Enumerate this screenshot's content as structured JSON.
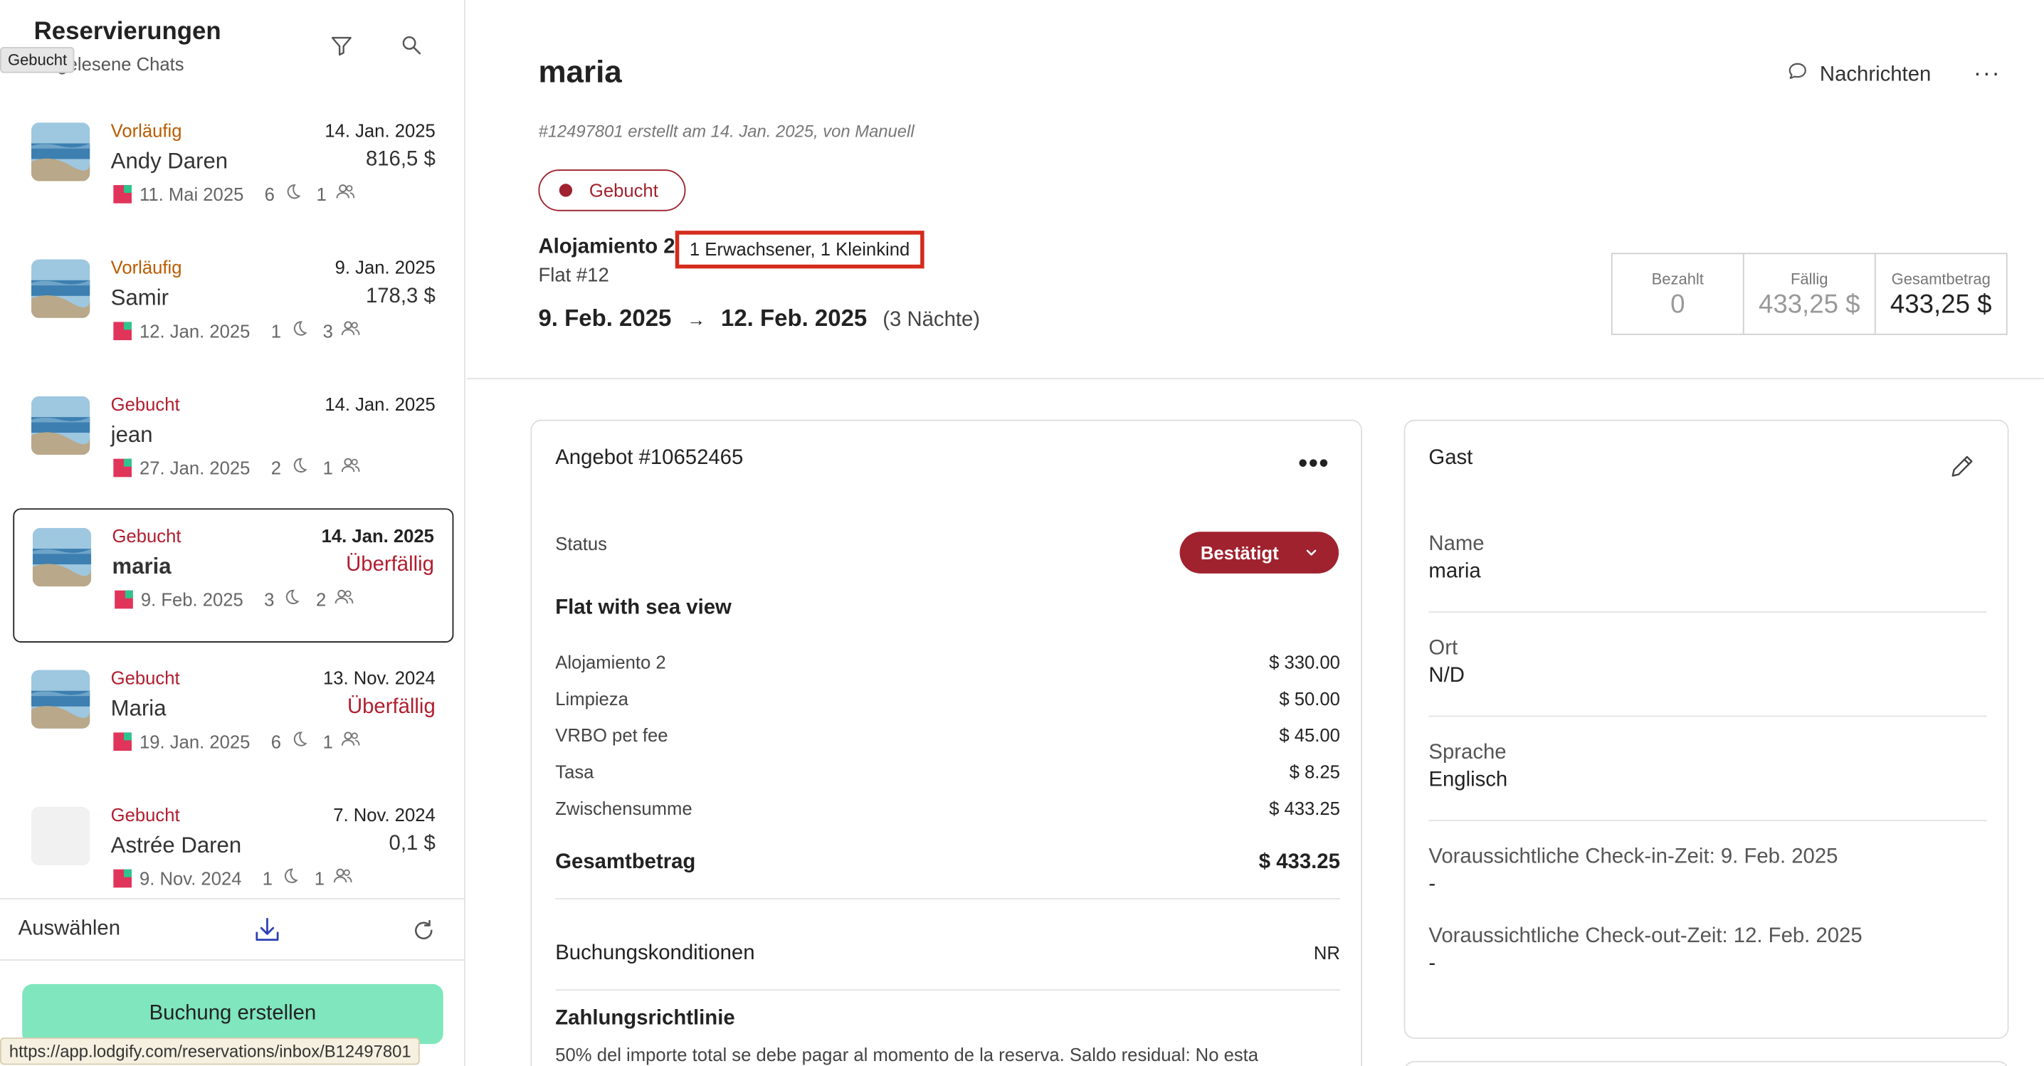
{
  "sidebar": {
    "title": "Reservierungen",
    "subtitle": "Ungelesene Chats",
    "tooltip": "Gebucht",
    "filter_icon": "filter-icon",
    "search_icon": "search-icon",
    "reservations": [
      {
        "status": "Vorläufig",
        "status_color": "#b85c00",
        "date": "14. Jan. 2025",
        "name": "Andy Daren",
        "amount": "816,5 $",
        "amount_color": "#333333",
        "checkin": "11. Mai 2025",
        "nights": "6",
        "guests": "1",
        "active": false,
        "thumb": true
      },
      {
        "status": "Vorläufig",
        "status_color": "#b85c00",
        "date": "9. Jan. 2025",
        "name": "Samir",
        "amount": "178,3 $",
        "amount_color": "#333333",
        "checkin": "12. Jan. 2025",
        "nights": "1",
        "guests": "3",
        "active": false,
        "thumb": true
      },
      {
        "status": "Gebucht",
        "status_color": "#b01e2f",
        "date": "14. Jan. 2025",
        "name": "jean",
        "amount": "",
        "amount_color": "#333333",
        "checkin": "27. Jan. 2025",
        "nights": "2",
        "guests": "1",
        "active": false,
        "thumb": true
      },
      {
        "status": "Gebucht",
        "status_color": "#b01e2f",
        "date": "14. Jan. 2025",
        "name": "maria",
        "amount": "Überfällig",
        "amount_color": "#b01e2f",
        "checkin": "9. Feb. 2025",
        "nights": "3",
        "guests": "2",
        "active": true,
        "thumb": true
      },
      {
        "status": "Gebucht",
        "status_color": "#b01e2f",
        "date": "13. Nov. 2024",
        "name": "Maria",
        "amount": "Überfällig",
        "amount_color": "#b01e2f",
        "checkin": "19. Jan. 2025",
        "nights": "6",
        "guests": "1",
        "active": false,
        "thumb": true
      },
      {
        "status": "Gebucht",
        "status_color": "#b01e2f",
        "date": "7. Nov. 2024",
        "name": "Astrée Daren",
        "amount": "0,1 $",
        "amount_color": "#333333",
        "checkin": "9. Nov. 2024",
        "nights": "1",
        "guests": "1",
        "active": false,
        "thumb": false
      }
    ],
    "select_label": "Auswählen",
    "download_icon": "download-icon",
    "refresh_icon": "refresh-icon",
    "create_button": "Buchung erstellen"
  },
  "statusbar": {
    "url": "https://app.lodgify.com/reservations/inbox/B12497801"
  },
  "header": {
    "guest_name": "maria",
    "subline": "#12497801 erstellt am 14. Jan. 2025, von Manuell",
    "messages_label": "Nachrichten",
    "more_label": "···",
    "badge": "Gebucht",
    "property": "Alojamiento 2",
    "guests_summary": "1 Erwachsener, 1 Kleinkind",
    "unit": "Flat #12",
    "date_from": "9. Feb. 2025",
    "date_arrow": "→",
    "date_to": "12. Feb. 2025",
    "nights": "(3 Nächte)"
  },
  "totals": [
    {
      "label": "Bezahlt",
      "value": "0"
    },
    {
      "label": "Fällig",
      "value": "433,25 $"
    },
    {
      "label": "Gesamtbetrag",
      "value": "433,25 $"
    }
  ],
  "offer": {
    "title": "Angebot #10652465",
    "menu": "•••",
    "status_label": "Status",
    "status_value": "Bestätigt",
    "subtitle": "Flat with sea view",
    "line_items": [
      {
        "label": "Alojamiento 2",
        "amount": "$ 330.00"
      },
      {
        "label": "Limpieza",
        "amount": "$ 50.00"
      },
      {
        "label": "VRBO pet fee",
        "amount": "$ 45.00"
      },
      {
        "label": "Tasa",
        "amount": "$ 8.25"
      },
      {
        "label": "Zwischensumme",
        "amount": "$ 433.25"
      }
    ],
    "total_label": "Gesamtbetrag",
    "total_amount": "$ 433.25",
    "conditions_label": "Buchungskonditionen",
    "conditions_value": "NR",
    "payment_title": "Zahlungsrichtlinie",
    "payment_text": "50% del importe total se debe pagar al momento de la reserva. Saldo residual: No esta"
  },
  "guest": {
    "title": "Gast",
    "name_label": "Name",
    "name_value": "maria",
    "location_label": "Ort",
    "location_value": "N/D",
    "language_label": "Sprache",
    "language_value": "Englisch",
    "checkin_label": "Voraussichtliche Check-in-Zeit: 9. Feb. 2025",
    "checkin_value": "-",
    "checkout_label": "Voraussichtliche Check-out-Zeit: 12. Feb. 2025",
    "checkout_value": "-"
  },
  "colors": {
    "brand_red": "#a0222e",
    "create_green": "#7fe6be",
    "highlight_red": "#d42b1c"
  }
}
